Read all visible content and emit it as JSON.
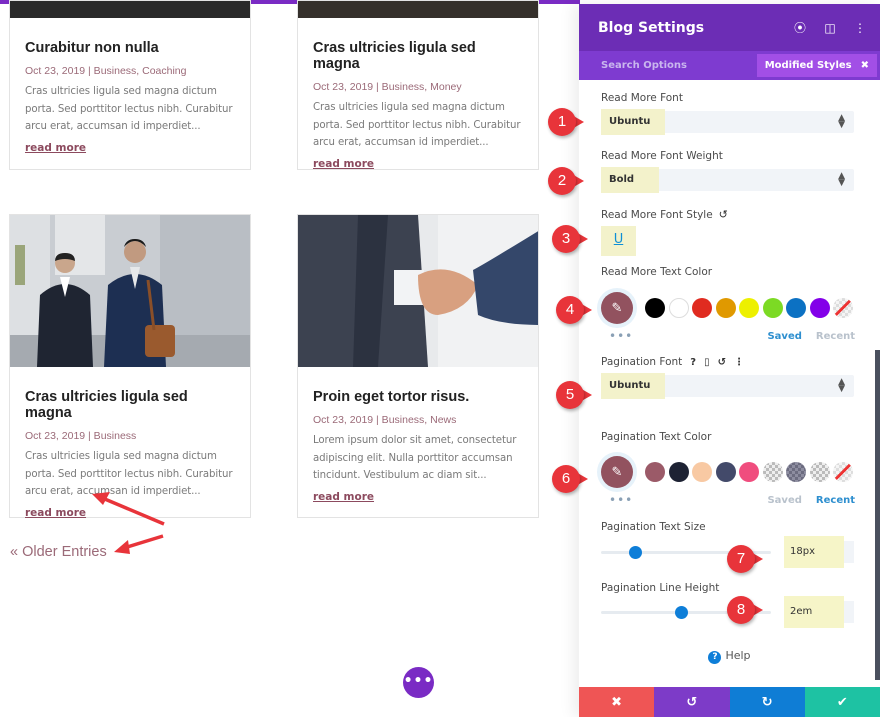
{
  "blog": {
    "posts": [
      {
        "title": "Curabitur non nulla",
        "meta": "Oct 23, 2019 | Business, Coaching",
        "excerpt": "Cras ultricies ligula sed magna dictum porta. Sed porttitor lectus nibh. Curabitur arcu erat, accumsan id imperdiet...",
        "read_more": "read more"
      },
      {
        "title": "Cras ultricies ligula sed magna",
        "meta": "Oct 23, 2019 | Business, Money",
        "excerpt": "Cras ultricies ligula sed magna dictum porta. Sed porttitor lectus nibh. Curabitur arcu erat, accumsan id imperdiet...",
        "read_more": "read more"
      },
      {
        "title": "Cras ultricies ligula sed magna",
        "meta": "Oct 23, 2019 | Business",
        "excerpt": "Cras ultricies ligula sed magna dictum porta. Sed porttitor lectus nibh. Curabitur arcu erat, accumsan id imperdiet...",
        "read_more": "read more"
      },
      {
        "title": "Proin eget tortor risus.",
        "meta": "Oct 23, 2019 | Business, News",
        "excerpt": "Lorem ipsum dolor sit amet, consectetur adipiscing elit. Nulla porttitor accumsan tincidunt. Vestibulum ac diam sit...",
        "read_more": "read more"
      }
    ],
    "older_entries": "« Older Entries",
    "fab_label": "•••"
  },
  "panel": {
    "title": "Blog Settings",
    "search_options": "Search Options",
    "modified_styles": "Modified Styles",
    "modified_close": "✖",
    "fields": {
      "read_more_font": {
        "label": "Read More Font",
        "value": "Ubuntu"
      },
      "read_more_font_weight": {
        "label": "Read More Font Weight",
        "value": "Bold"
      },
      "read_more_font_style": {
        "label": "Read More Font Style",
        "value": "U"
      },
      "read_more_text_color": {
        "label": "Read More Text Color",
        "current": "#92525f",
        "swatches": [
          "#000000",
          "#ffffff",
          "#e02b20",
          "#e09900",
          "#edf000",
          "#7cda24",
          "#0c71c3",
          "#8300e9",
          "none"
        ],
        "tabs": [
          "Saved",
          "Recent"
        ],
        "active_tab": "Saved"
      },
      "pagination_font": {
        "label": "Pagination Font",
        "value": "Ubuntu"
      },
      "pagination_text_color": {
        "label": "Pagination Text Color",
        "current": "#92525f",
        "swatches": [
          "#9b5a68",
          "#1d2233",
          "#f8c9a3",
          "#434a6a",
          "#f04d7e",
          "checker",
          "checker-dark",
          "checker",
          "none"
        ],
        "tabs": [
          "Saved",
          "Recent"
        ],
        "active_tab": "Recent"
      },
      "pagination_text_size": {
        "label": "Pagination Text Size",
        "value": "18px",
        "slider_fraction": 0.18
      },
      "pagination_line_height": {
        "label": "Pagination Line Height",
        "value": "2em",
        "slider_fraction": 0.47
      }
    },
    "help": "Help",
    "footer": {
      "cancel": "✖",
      "undo": "↺",
      "redo": "↻",
      "save": "✔"
    },
    "colors": {
      "header": "#6c2db5",
      "subheader": "#7e3bd0",
      "cancel": "#ef5555",
      "undo": "#7d3bc8",
      "redo": "#0f7dd5",
      "save": "#1ec2a3"
    }
  },
  "markers": [
    "1",
    "2",
    "3",
    "4",
    "5",
    "6",
    "7",
    "8"
  ]
}
